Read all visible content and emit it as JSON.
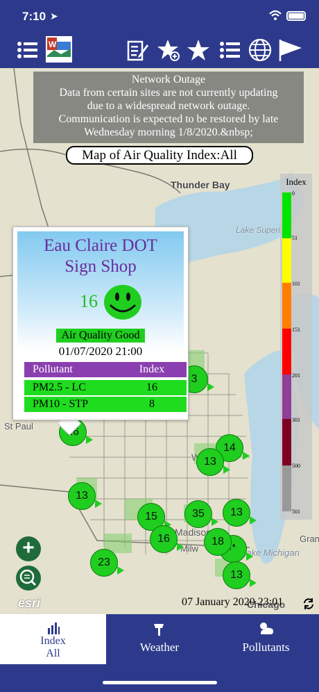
{
  "status": {
    "time": "7:10",
    "location_arrow": "➤"
  },
  "toolbar": {
    "icons": [
      "list-icon",
      "wisconsin-aqi-logo",
      "edit-icon",
      "add-favorite-icon",
      "favorites-star-icon",
      "list-icon",
      "globe-icon",
      "flag-icon"
    ],
    "logo_text": "WisconsinAQI"
  },
  "outage": {
    "title": "Network Outage",
    "line1": "Data from certain sites are not currently updating",
    "line2": "due to a widespread network outage.",
    "line3": "Communication is expected to be restored by late",
    "line4": "Wednesday morning 1/8/2020.&nbsp;"
  },
  "map": {
    "title": "Map of Air Quality Index:All",
    "places": {
      "thunder_bay": "Thunder Bay",
      "lake_superior": "Lake Superior",
      "lake_michigan": "Lake Michigan",
      "st_paul": "St Paul",
      "wisconsin": "Wisc",
      "madison": "Madison",
      "milwaukee": "Milw",
      "chicago": "Chicago",
      "grand": "Gran"
    },
    "markers": [
      "16",
      "13",
      "14",
      "13",
      "15",
      "35",
      "13",
      "16",
      "18",
      "4",
      "23",
      "13",
      "3"
    ],
    "timestamp": "07 January 2020 23:01",
    "attribution": "esri",
    "zoom_label": "+"
  },
  "legend": {
    "title": "Index",
    "ticks": [
      "0",
      "51",
      "101",
      "151",
      "201",
      "301",
      "500",
      "501"
    ],
    "colors": [
      "#00e400",
      "#ffff00",
      "#ff7e00",
      "#ff0000",
      "#8f3f97",
      "#7e0023",
      "#999999"
    ]
  },
  "popup": {
    "name_line1": "Eau Claire DOT",
    "name_line2": "Sign Shop",
    "value": "16",
    "aqi_text": "Air Quality Good",
    "datetime": "01/07/2020 21:00",
    "header": {
      "pollutant": "Pollutant",
      "index": "Index"
    },
    "rows": [
      {
        "pollutant": "PM2.5 - LC",
        "index": "16"
      },
      {
        "pollutant": "PM10 - STP",
        "index": "8"
      }
    ]
  },
  "tabs": [
    {
      "label_line1": "Index",
      "label_line2": "All",
      "icon": "bar-chart-icon",
      "active": true
    },
    {
      "label": "Weather",
      "icon": "weather-icon",
      "active": false
    },
    {
      "label": "Pollutants",
      "icon": "pollutants-icon",
      "active": false
    }
  ]
}
